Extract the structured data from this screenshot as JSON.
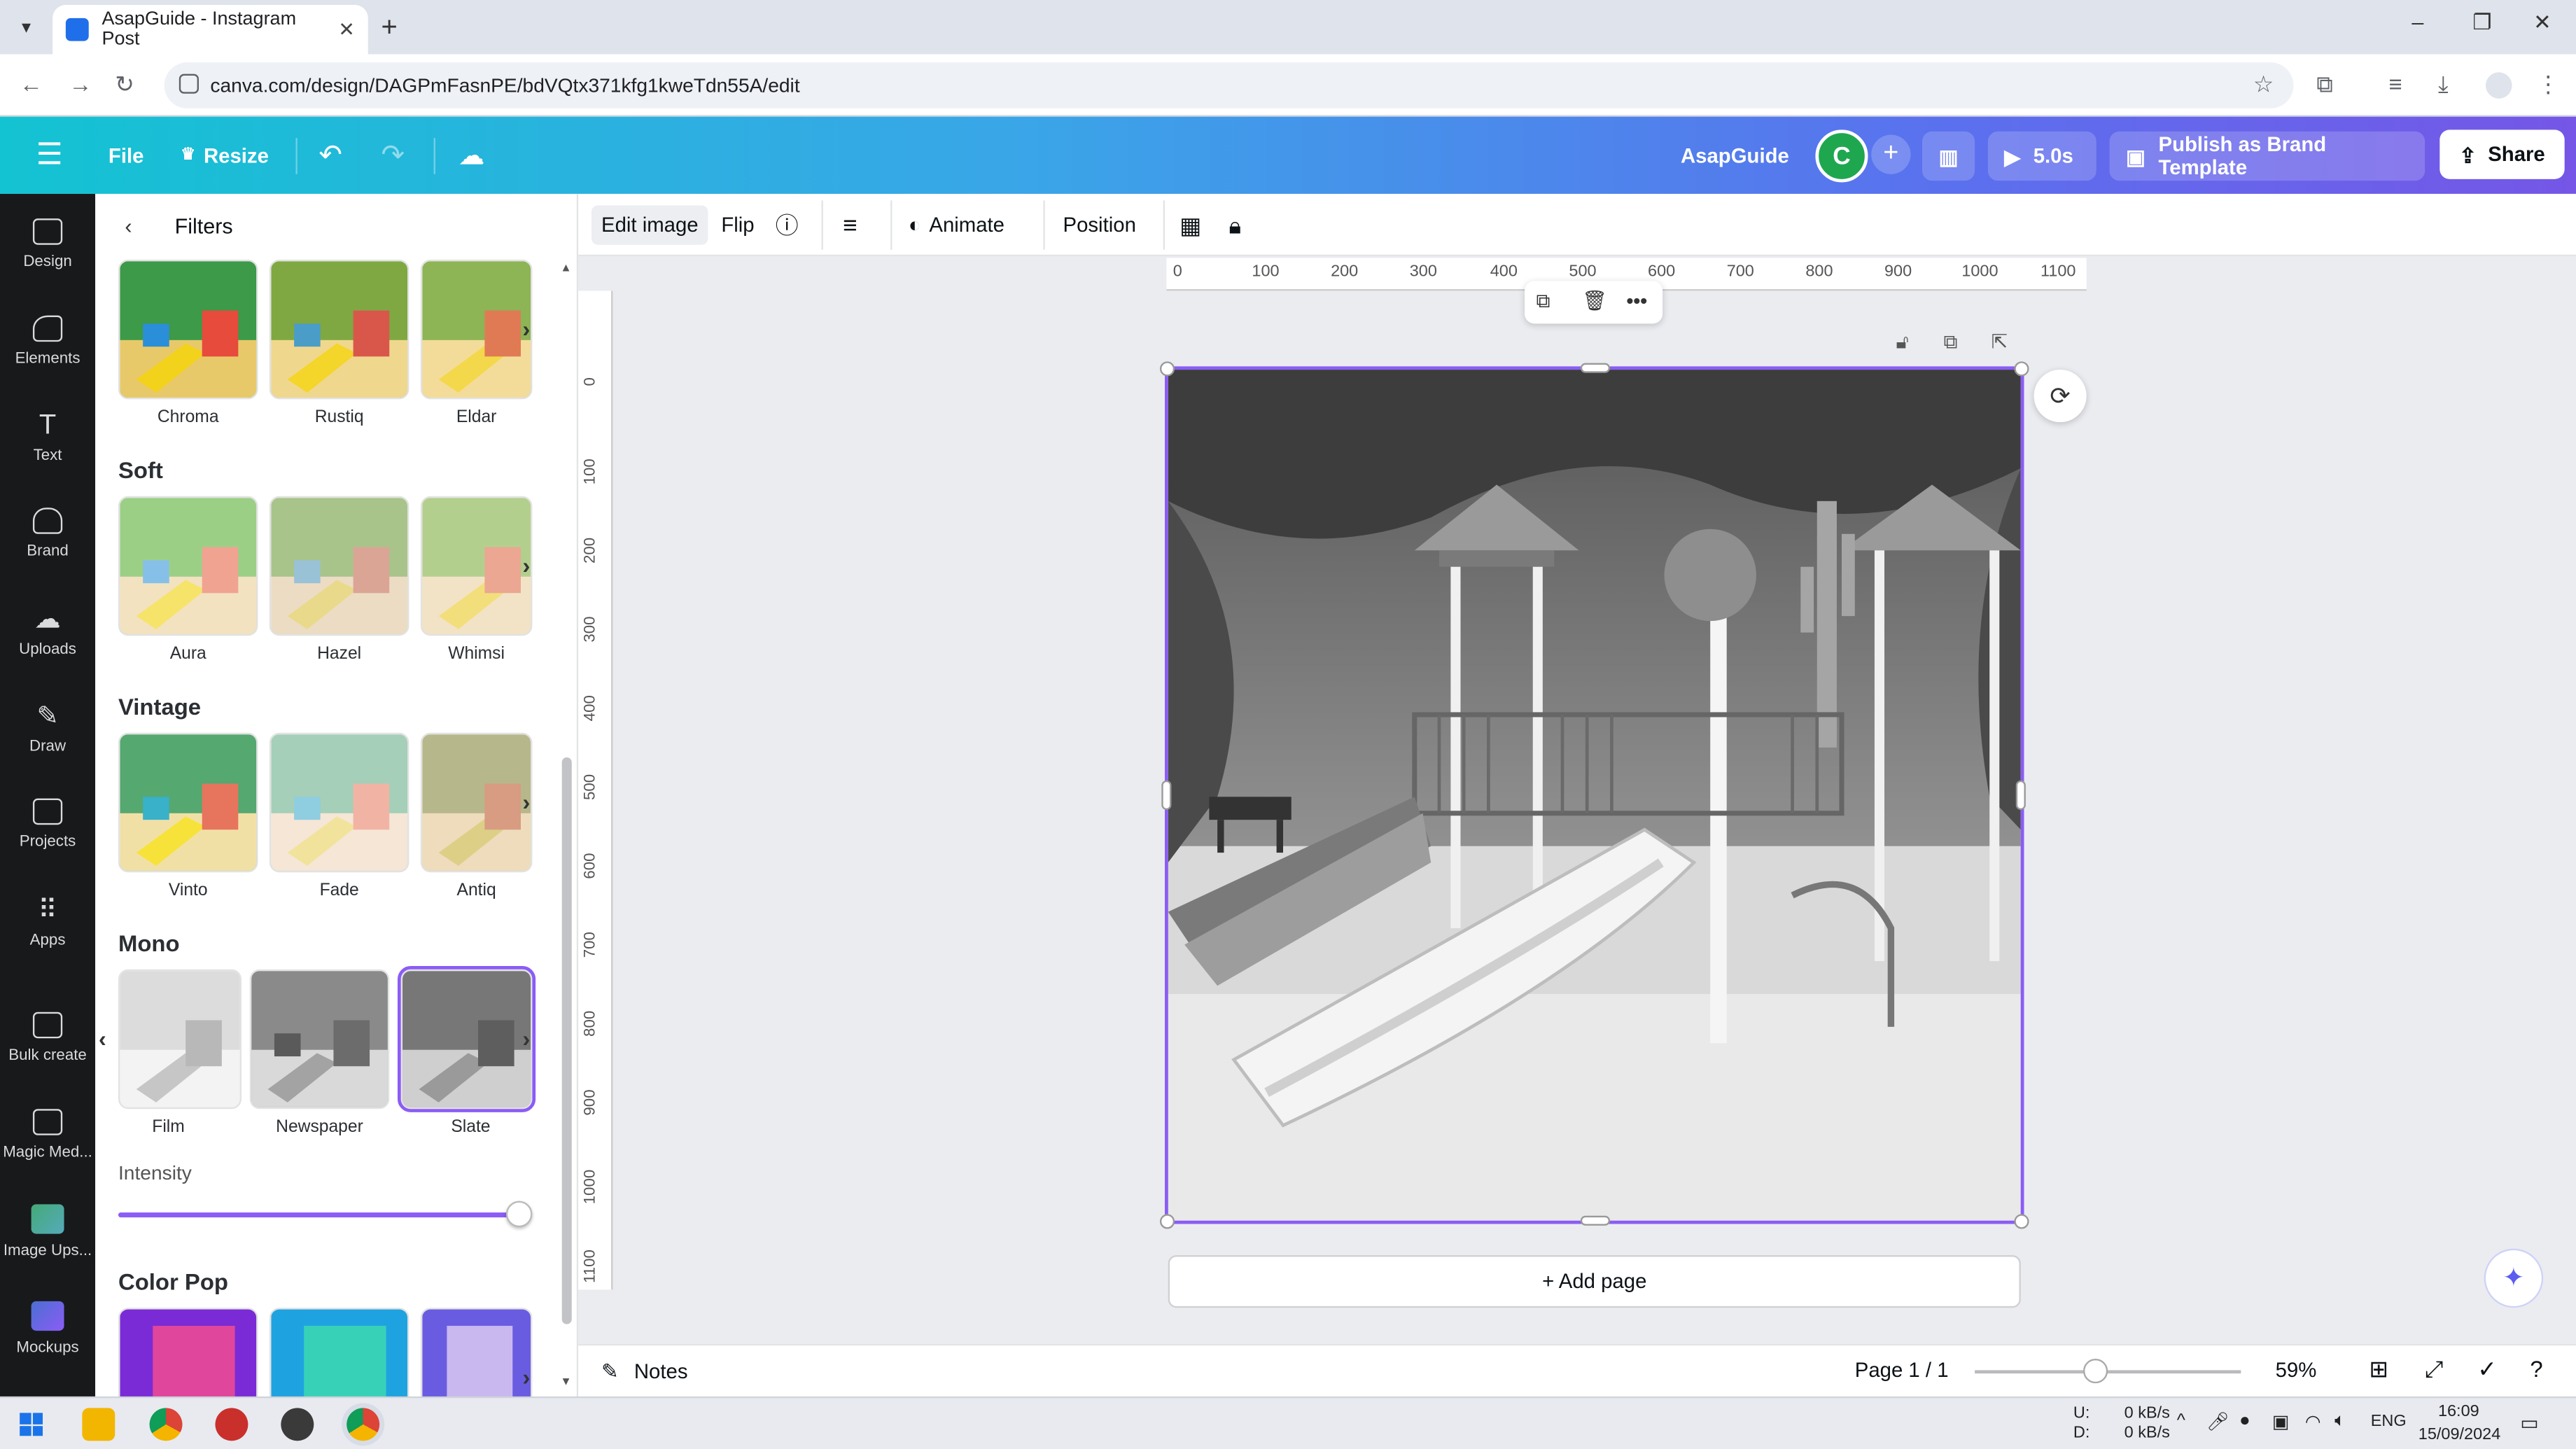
{
  "browser": {
    "tab_title": "AsapGuide - Instagram Post",
    "tab_close": "✕",
    "new_tab": "+",
    "url": "canva.com/design/DAGPmFasnPE/bdVQtx371kfg1kweTdn55A/edit",
    "window_controls": [
      "–",
      "❐",
      "✕"
    ]
  },
  "topbar": {
    "file_label": "File",
    "resize_label": "Resize",
    "brand_label": "AsapGuide",
    "avatar_initial": "C",
    "plus": "+",
    "timer_label": "5.0s",
    "publish_label": "Publish as Brand Template",
    "share_label": "Share"
  },
  "rail": [
    {
      "label": "Design",
      "icon": "design-icon"
    },
    {
      "label": "Elements",
      "icon": "elements-icon"
    },
    {
      "label": "Text",
      "icon": "text-icon"
    },
    {
      "label": "Brand",
      "icon": "brand-icon"
    },
    {
      "label": "Uploads",
      "icon": "uploads-icon"
    },
    {
      "label": "Draw",
      "icon": "draw-icon"
    },
    {
      "label": "Projects",
      "icon": "projects-icon"
    },
    {
      "label": "Apps",
      "icon": "apps-icon"
    },
    {
      "label": "Bulk create",
      "icon": "bulk-create-icon"
    },
    {
      "label": "Magic Med...",
      "icon": "magic-media-icon"
    },
    {
      "label": "Image Ups...",
      "icon": "image-upscaler-icon"
    },
    {
      "label": "Mockups",
      "icon": "mockups-icon"
    }
  ],
  "panel": {
    "title": "Filters",
    "sections": [
      {
        "title": "",
        "filters": [
          "Chroma",
          "Rustiq",
          "Eldar"
        ]
      },
      {
        "title": "Soft",
        "filters": [
          "Aura",
          "Hazel",
          "Whimsi"
        ]
      },
      {
        "title": "Vintage",
        "filters": [
          "Vinto",
          "Fade",
          "Antiq"
        ]
      },
      {
        "title": "Mono",
        "filters": [
          "Film",
          "Newspaper",
          "Slate"
        ]
      },
      {
        "title": "Color Pop",
        "filters": [
          "",
          "",
          ""
        ]
      }
    ],
    "intensity_label": "Intensity",
    "intensity_value": 1.0
  },
  "context_toolbar": {
    "edit_image": "Edit image",
    "flip": "Flip",
    "animate": "Animate",
    "position": "Position"
  },
  "ruler": {
    "horizontal": [
      "0",
      "100",
      "200",
      "300",
      "400",
      "500",
      "600",
      "700",
      "800",
      "900",
      "1000",
      "1100"
    ],
    "vertical": [
      "0",
      "100",
      "200",
      "300",
      "400",
      "500",
      "600",
      "700",
      "800",
      "900",
      "1000",
      "1100"
    ]
  },
  "canvas": {
    "add_page_label": "+ Add page"
  },
  "bottombar": {
    "notes_label": "Notes",
    "page_label": "Page 1 / 1",
    "zoom_label": "59%",
    "zoom_value": 0.59
  },
  "taskbar": {
    "net_up_label": "U:",
    "net_down_label": "D:",
    "net_up": "0 kB/s",
    "net_down": "0 kB/s",
    "language": "ENG",
    "time": "16:09",
    "date": "15/09/2024"
  },
  "colors": {
    "accent": "#8b5cf6",
    "topbar_start": "#13c3d2",
    "topbar_end": "#7556e7",
    "rail_bg": "#18191b"
  }
}
